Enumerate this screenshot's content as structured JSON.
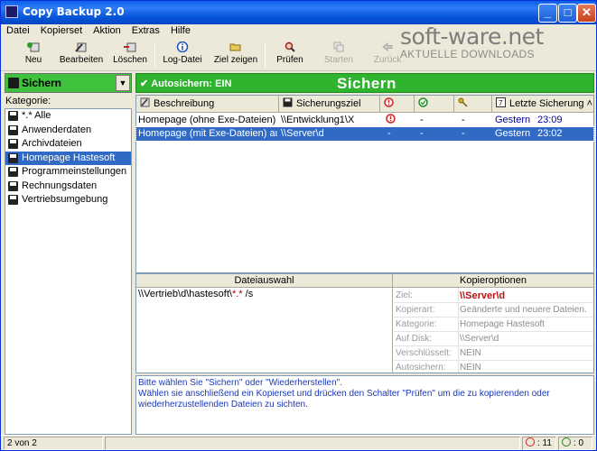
{
  "window": {
    "title": "Copy Backup 2.0"
  },
  "menu": [
    "Datei",
    "Kopierset",
    "Aktion",
    "Extras",
    "Hilfe"
  ],
  "toolbar": {
    "new": "Neu",
    "edit": "Bearbeiten",
    "delete": "Löschen",
    "log": "Log-Datei",
    "show_target": "Ziel zeigen",
    "check": "Prüfen",
    "start": "Starten",
    "back": "Zurück"
  },
  "watermark": {
    "title": "soft-ware.net",
    "subtitle": "AKTUELLE DOWNLOADS"
  },
  "left": {
    "combo_value": "Sichern",
    "category_label": "Kategorie:",
    "categories": [
      "*.* Alle",
      "Anwenderdaten",
      "Archivdateien",
      "Homepage Hastesoft",
      "Programmeinstellungen",
      "Rechnungsdaten",
      "Vertriebsumgebung"
    ]
  },
  "banner": {
    "autosave": "Autosichern: EIN",
    "headline": "Sichern"
  },
  "grid": {
    "columns": [
      "Beschreibung",
      "Sicherungsziel",
      "",
      "",
      "",
      "Letzte Sicherung"
    ],
    "rows": [
      {
        "desc": "Homepage (ohne Exe-Dateien) auf...",
        "target": "\\\\Entwicklung1\\X",
        "c1": "",
        "c2": "-",
        "c3": "-",
        "date": "Gestern",
        "time": "23:09"
      },
      {
        "desc": "Homepage (mit Exe-Dateien) auf S...",
        "target": "\\\\Server\\d",
        "c1": "-",
        "c2": "-",
        "c3": "-",
        "date": "Gestern",
        "time": "23:02"
      }
    ]
  },
  "bottom": {
    "file_header": "Dateiauswahl",
    "file_path": "\\\\Vertrieb\\d\\hastesoft\\",
    "file_pattern": "*.*",
    "file_suffix": " /s",
    "options_header": "Kopieroptionen",
    "options": [
      {
        "key": "Ziel:",
        "value": "\\\\Server\\d"
      },
      {
        "key": "Kopierart:",
        "value": "Geänderte und neuere Dateien."
      },
      {
        "key": "Kategorie:",
        "value": "Homepage Hastesoft"
      },
      {
        "key": "Auf Disk:",
        "value": "\\\\Server\\d"
      },
      {
        "key": "Verschlüsselt:",
        "value": "NEIN"
      },
      {
        "key": "Autosichern:",
        "value": "NEIN"
      }
    ]
  },
  "info": {
    "line1": "Bitte wählen Sie \"Sichern\" oder \"Wiederherstellen\".",
    "line2": "Wählen sie anschließend ein Kopierset und drücken den Schalter \"Prüfen\" um die zu kopierenden oder wiederherzustellenden Dateien zu sichten."
  },
  "status": {
    "position": "2 von 2",
    "errors": ": 11",
    "ok": ": 0"
  },
  "colors": {
    "green": "#2fb42f",
    "selection": "#316ac5",
    "info_text": "#1a38b8"
  }
}
